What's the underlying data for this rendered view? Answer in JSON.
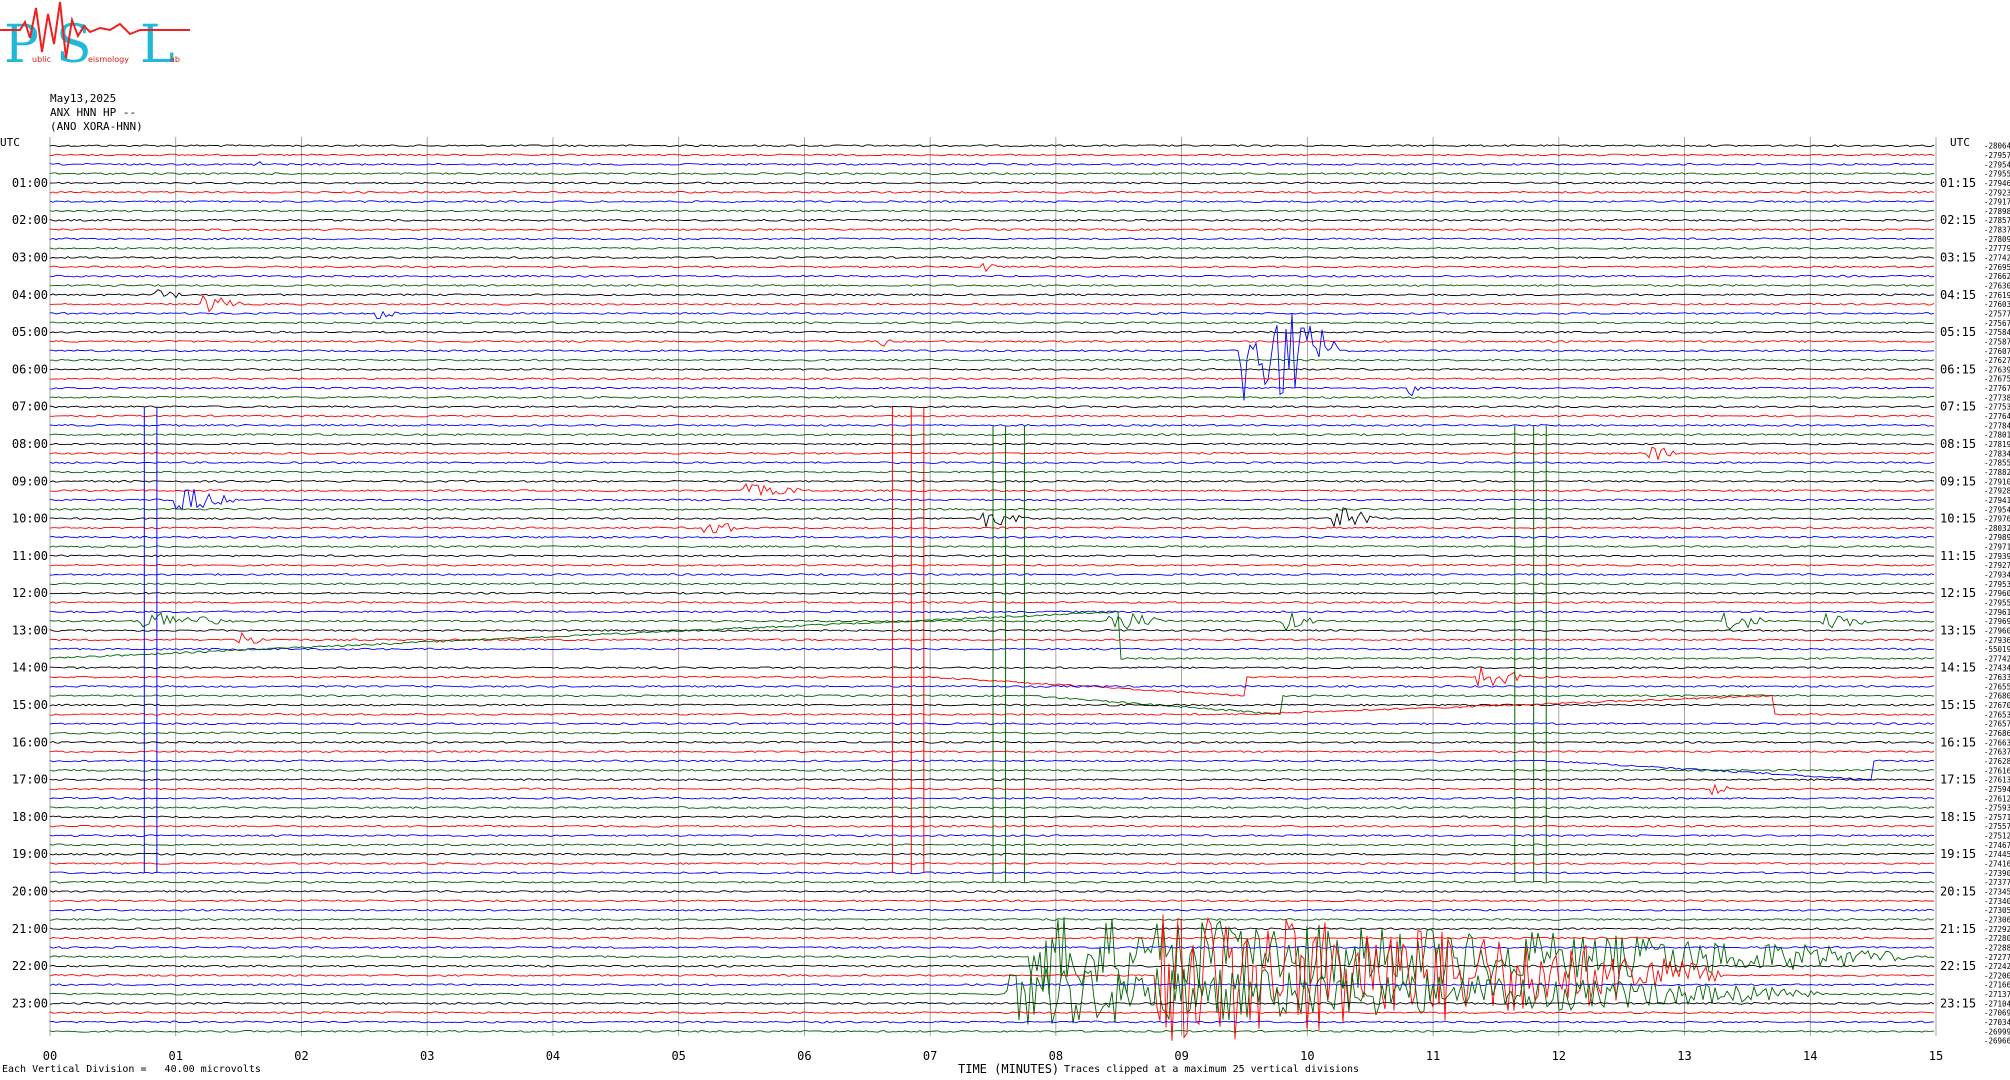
{
  "logo": {
    "letters": [
      "P",
      "S",
      "L"
    ],
    "small_text": [
      "ublic",
      "eismology",
      "ab"
    ]
  },
  "header": {
    "date": "May13,2025",
    "station": "ANX HNN HP --",
    "network": "(ANO XORA-HNN)"
  },
  "footer": {
    "vertical_division": "Each Vertical Division =   40.00 microvolts",
    "time_label": "TIME (MINUTES)",
    "clip_note": "Traces clipped at a maximum 25 vertical divisions"
  },
  "chart_data": {
    "type": "line",
    "title": "",
    "xlabel": "TIME (MINUTES)",
    "ylabel": "",
    "xlim": [
      0,
      15
    ],
    "x_ticks": [
      "00",
      "01",
      "02",
      "03",
      "04",
      "05",
      "06",
      "07",
      "08",
      "09",
      "10",
      "11",
      "12",
      "13",
      "14",
      "15"
    ],
    "trace_colors": [
      "#000000",
      "#ff0000",
      "#0000ff",
      "#006400"
    ],
    "traces_per_row": 96,
    "left_axis_label": "UTC",
    "right_axis_label": "UTC",
    "left_hours": [
      "01:00",
      "02:00",
      "03:00",
      "04:00",
      "05:00",
      "06:00",
      "07:00",
      "08:00",
      "09:00",
      "10:00",
      "11:00",
      "12:00",
      "13:00",
      "14:00",
      "15:00",
      "16:00",
      "17:00",
      "18:00",
      "19:00",
      "20:00",
      "21:00",
      "22:00",
      "23:00"
    ],
    "right_hours": [
      "01:15",
      "02:15",
      "03:15",
      "04:15",
      "05:15",
      "06:15",
      "07:15",
      "08:15",
      "09:15",
      "10:15",
      "11:15",
      "12:15",
      "13:15",
      "14:15",
      "15:15",
      "16:15",
      "17:15",
      "18:15",
      "19:15",
      "20:15",
      "21:15",
      "22:15",
      "23:15"
    ],
    "right_offsets": [
      "-28064",
      "-27957",
      "-27954",
      "-27955",
      "-27946",
      "-27923",
      "-27917",
      "-27898",
      "-27857",
      "-27837",
      "-27809",
      "-27779",
      "-27742",
      "-27695",
      "-27662",
      "-27630",
      "-27619",
      "-27603",
      "-27577",
      "-27567",
      "-27584",
      "-27587",
      "-27607",
      "-27627",
      "-27639",
      "-27675",
      "-27767",
      "-27738",
      "-27753",
      "-27764",
      "-27784",
      "-27801",
      "-27819",
      "-27834",
      "-27855",
      "-27882",
      "-27910",
      "-27928",
      "-27941",
      "-27954",
      "-27976",
      "-28032",
      "-27989",
      "-27971",
      "-27939",
      "-27927",
      "-27934",
      "-27953",
      "-27960",
      "-27955",
      "-27961",
      "-27969",
      "-27960",
      "-27936",
      "-55019",
      "-27742",
      "-27434",
      "-27633",
      "-27655",
      "-27680",
      "-27670",
      "-27653",
      "-27657",
      "-27686",
      "-27663",
      "-27637",
      "-27628",
      "-27616",
      "-27613",
      "-27594",
      "-27612",
      "-27593",
      "-27571",
      "-27557",
      "-27512",
      "-27467",
      "-27445",
      "-27416",
      "-27390",
      "-27377",
      "-27345",
      "-27340",
      "-27305",
      "-27306",
      "-27292",
      "-27280",
      "-27288",
      "-27277",
      "-27242",
      "-27200",
      "-27166",
      "-27137",
      "-27104",
      "-27069",
      "-27034",
      "-26999",
      "-26966"
    ],
    "events": [
      {
        "row": 2,
        "minute": 1.6,
        "amp": 1.5,
        "dur": 0.1,
        "sign": "local"
      },
      {
        "row": 13,
        "minute": 7.4,
        "amp": 1.5,
        "dur": 0.15,
        "sign": "local"
      },
      {
        "row": 16,
        "minute": 0.8,
        "amp": 1.2,
        "dur": 0.3,
        "sign": "local"
      },
      {
        "row": 17,
        "minute": 1.2,
        "amp": 2.0,
        "dur": 0.35,
        "sign": "local"
      },
      {
        "row": 18,
        "minute": 2.6,
        "amp": 1.5,
        "dur": 0.2,
        "sign": "local"
      },
      {
        "row": 21,
        "minute": 6.6,
        "amp": 1.5,
        "dur": 0.1,
        "sign": "local"
      },
      {
        "row": 22,
        "minute": 9.45,
        "amp": 12.0,
        "dur": 0.8,
        "sign": "quake"
      },
      {
        "row": 26,
        "minute": 10.8,
        "amp": 2.0,
        "dur": 0.1,
        "sign": "local"
      },
      {
        "row": 33,
        "minute": 12.7,
        "amp": 1.5,
        "dur": 0.3,
        "sign": "local"
      },
      {
        "row": 37,
        "minute": 5.5,
        "amp": 1.2,
        "dur": 0.6,
        "sign": "local"
      },
      {
        "row": 38,
        "minute": 1.0,
        "amp": 3.0,
        "dur": 0.5,
        "sign": "local"
      },
      {
        "row": 40,
        "minute": 7.4,
        "amp": 2.0,
        "dur": 0.4,
        "sign": "local"
      },
      {
        "row": 40,
        "minute": 10.2,
        "amp": 2.5,
        "dur": 0.4,
        "sign": "local"
      },
      {
        "row": 41,
        "minute": 5.2,
        "amp": 2.0,
        "dur": 0.3,
        "sign": "local"
      },
      {
        "row": 51,
        "minute": 0.7,
        "amp": 2.0,
        "dur": 0.8,
        "sign": "local"
      },
      {
        "row": 51,
        "minute": 8.4,
        "amp": 2.5,
        "dur": 0.5,
        "sign": "local"
      },
      {
        "row": 51,
        "minute": 9.8,
        "amp": 2.0,
        "dur": 0.3,
        "sign": "local"
      },
      {
        "row": 51,
        "minute": 13.3,
        "amp": 2.5,
        "dur": 0.4,
        "sign": "local"
      },
      {
        "row": 51,
        "minute": 14.1,
        "amp": 2.0,
        "dur": 0.4,
        "sign": "local"
      },
      {
        "row": 53,
        "minute": 1.5,
        "amp": 1.5,
        "dur": 0.3,
        "sign": "local"
      },
      {
        "row": 57,
        "minute": 11.3,
        "amp": 2.5,
        "dur": 0.5,
        "sign": "local"
      },
      {
        "row": 69,
        "minute": 13.2,
        "amp": 1.2,
        "dur": 0.2,
        "sign": "local"
      },
      {
        "row": 87,
        "minute": 7.8,
        "amp": 8.0,
        "dur": 7.0,
        "sign": "quake"
      },
      {
        "row": 89,
        "minute": 8.8,
        "amp": 14.0,
        "dur": 4.5,
        "sign": "quake"
      },
      {
        "row": 91,
        "minute": 7.6,
        "amp": 6.0,
        "dur": 6.5,
        "sign": "quake"
      }
    ],
    "glitches": [
      {
        "minute": 0.75,
        "row_from": 28,
        "row_to": 78,
        "color": "#0000ff"
      },
      {
        "minute": 0.85,
        "row_from": 28,
        "row_to": 78,
        "color": "#0000ff"
      },
      {
        "minute": 6.7,
        "row_from": 28,
        "row_to": 78,
        "color": "#ff0000"
      },
      {
        "minute": 6.85,
        "row_from": 28,
        "row_to": 78,
        "color": "#ff0000"
      },
      {
        "minute": 6.95,
        "row_from": 28,
        "row_to": 78,
        "color": "#ff0000"
      },
      {
        "minute": 7.5,
        "row_from": 30,
        "row_to": 79,
        "color": "#006400"
      },
      {
        "minute": 7.6,
        "row_from": 30,
        "row_to": 79,
        "color": "#006400"
      },
      {
        "minute": 7.75,
        "row_from": 30,
        "row_to": 79,
        "color": "#006400"
      },
      {
        "minute": 11.65,
        "row_from": 30,
        "row_to": 79,
        "color": "#006400"
      },
      {
        "minute": 11.8,
        "row_from": 30,
        "row_to": 79,
        "color": "#006400"
      },
      {
        "minute": 11.9,
        "row_from": 30,
        "row_to": 79,
        "color": "#006400"
      }
    ],
    "drifts": [
      {
        "row": 55,
        "from_minute": 0.0,
        "to_minute": 8.5,
        "rise": -5.0,
        "color": "#000000"
      },
      {
        "row": 57,
        "from_minute": 7.0,
        "to_minute": 9.5,
        "rise": 2.0,
        "color": "#ff0000"
      },
      {
        "row": 59,
        "from_minute": 7.8,
        "to_minute": 9.8,
        "rise": 2.0,
        "color": "#006400"
      },
      {
        "row": 61,
        "from_minute": 9.5,
        "to_minute": 13.7,
        "rise": -2.0,
        "color": "#ff0000"
      },
      {
        "row": 66,
        "from_minute": 11.9,
        "to_minute": 14.5,
        "rise": 2.0,
        "color": "#006400"
      }
    ]
  }
}
